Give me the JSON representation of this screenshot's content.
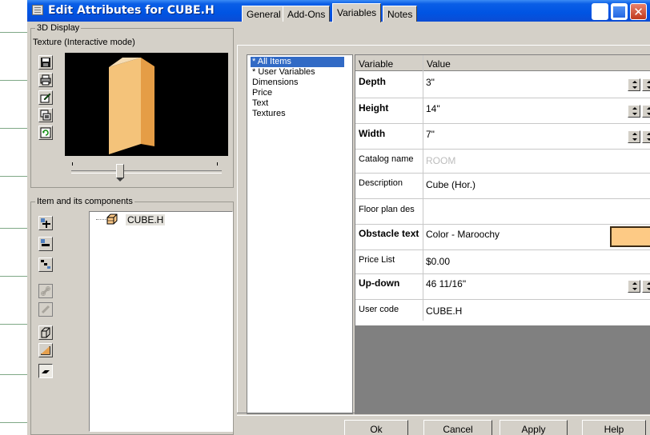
{
  "window": {
    "title": "Edit Attributes for CUBE.H"
  },
  "display_group": {
    "label": "3D Display",
    "mode": "Texture (Interactive mode)",
    "cube_color": "#f4c37a"
  },
  "components_group": {
    "label": "Item and its components",
    "tree_item": "CUBE.H"
  },
  "tabs": [
    {
      "label": "General",
      "active": false
    },
    {
      "label": "Add-Ons",
      "active": false
    },
    {
      "label": "Variables",
      "active": true
    },
    {
      "label": "Notes",
      "active": false
    }
  ],
  "categories": [
    {
      "label": "* All Items",
      "selected": true
    },
    {
      "label": "* User Variables",
      "selected": false
    },
    {
      "label": "Dimensions",
      "selected": false
    },
    {
      "label": "Price",
      "selected": false
    },
    {
      "label": "Text",
      "selected": false
    },
    {
      "label": "Textures",
      "selected": false
    }
  ],
  "grid": {
    "col_variable": "Variable",
    "col_value": "Value",
    "rows": [
      {
        "name": "Depth",
        "value": "3\"",
        "bold": true,
        "spinner": true
      },
      {
        "name": "Height",
        "value": "14\"",
        "bold": true,
        "spinner": true
      },
      {
        "name": "Width",
        "value": "7\"",
        "bold": true,
        "spinner": true
      },
      {
        "name": "Catalog name",
        "value": "ROOM",
        "bold": false,
        "disabled": true
      },
      {
        "name": "Description",
        "value": "Cube (Hor.)",
        "bold": false
      },
      {
        "name": "Floor plan des",
        "value": "",
        "bold": false
      },
      {
        "name": "Obstacle text",
        "value": "Color - Maroochy",
        "bold": true,
        "swatch": "#fdca85"
      },
      {
        "name": "Price List",
        "value": "$0.00",
        "bold": false
      },
      {
        "name": "Up-down",
        "value": "46 11/16\"",
        "bold": true,
        "spinner": true
      },
      {
        "name": "User code",
        "value": "CUBE.H",
        "bold": false
      }
    ]
  },
  "buttons": {
    "ok": "Ok",
    "cancel": "Cancel",
    "apply": "Apply",
    "help": "Help"
  }
}
